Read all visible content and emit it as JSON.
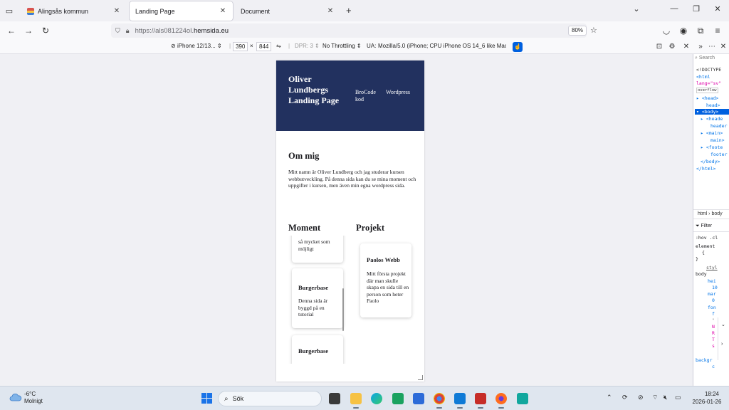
{
  "browser": {
    "tabs": [
      {
        "title": "Alingsås kommun",
        "active": false
      },
      {
        "title": "Landing Page",
        "active": true
      },
      {
        "title": "Document",
        "active": false
      }
    ],
    "url_prefix": "https://als081224ol.",
    "url_host": "hemsida.eu",
    "zoom": "80%"
  },
  "rdm": {
    "device": "iPhone 12/13...",
    "width": "390",
    "times": "×",
    "height": "844",
    "dpr": "DPR: 3",
    "throttling": "No Throttling",
    "ua_label": "UA:",
    "ua_value": "Mozilla/5.0 (iPhone; CPU iPhone OS 14_6 like Mac"
  },
  "site": {
    "title": "Oliver Lundbergs Landing Page",
    "nav": [
      {
        "label": "BroCode kod"
      },
      {
        "label": "Wordpress"
      }
    ],
    "about_heading": "Om mig",
    "about_text": "Mitt namn är Oliver Lundberg och jag studerar kursen webbutveckling. På denna sida kan du se mina moment och uppgifter i kursen, men även min egna wordpress sida.",
    "moment_heading": "Moment",
    "projekt_heading": "Projekt",
    "moment_cards": [
      {
        "title": "",
        "text": "så mycket som möjligt"
      },
      {
        "title": "Burgerbase",
        "text": "Denna sida är byggd på en tutorial"
      },
      {
        "title": "Burgerbase",
        "text": ""
      }
    ],
    "projekt_cards": [
      {
        "title": "Paolos Webb",
        "text": "Mitt första projekt där man skulle skapa en sida till en person som heter Paolo"
      }
    ]
  },
  "devtools": {
    "search_placeholder": "Search",
    "tree": [
      {
        "text": "<!DOCTYPE",
        "selected": false
      },
      {
        "text": "<html",
        "selected": false
      },
      {
        "text": "lang=\"sv\"",
        "selected": false
      },
      {
        "text": "overflow",
        "selected": false
      },
      {
        "text": "▸ <head>",
        "selected": false
      },
      {
        "text": "head>",
        "selected": false
      },
      {
        "text": "▾ <body>",
        "selected": true
      },
      {
        "text": "▸ <heade",
        "selected": false
      },
      {
        "text": "header",
        "selected": false
      },
      {
        "text": "▸ <main>",
        "selected": false
      },
      {
        "text": "main>",
        "selected": false
      },
      {
        "text": "▸ <foote",
        "selected": false
      },
      {
        "text": "footer",
        "selected": false
      },
      {
        "text": "</body>",
        "selected": false
      },
      {
        "text": "</html>",
        "selected": false
      }
    ],
    "breadcrumb": "html › body",
    "filter_label": "Filter",
    "rules": [
      ":hov .cl",
      "element",
      "{",
      "}",
      "styl",
      "body",
      "hei",
      "10",
      "mar",
      "0",
      "fon",
      "f",
      "'",
      "N",
      "R",
      "T",
      "s",
      "backgr",
      "c"
    ]
  },
  "taskbar": {
    "temperature": "-6°C",
    "weather": "Molnigt",
    "search_label": "Sök",
    "time": "18:24",
    "date": "2026-01-26"
  }
}
